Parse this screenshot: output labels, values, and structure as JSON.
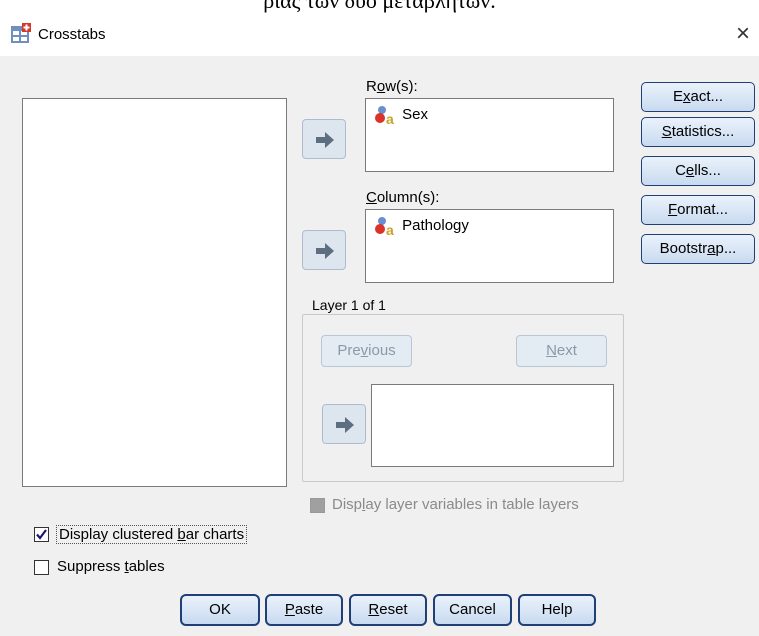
{
  "document": {
    "overlay_text": "ριας των δύο μεταβλητών."
  },
  "window": {
    "title": "Crosstabs",
    "close_symbol": "×"
  },
  "rows": {
    "label": "Row(s):",
    "items": [
      {
        "name": "Sex",
        "icon": "nominal-variable-icon"
      }
    ]
  },
  "columns": {
    "label": "Column(s):",
    "items": [
      {
        "name": "Pathology",
        "icon": "nominal-variable-icon"
      }
    ]
  },
  "layer": {
    "legend": "Layer 1 of 1",
    "previous_label": "Previous",
    "next_label": "Next",
    "display_in_table_layers_label": "Display layer variables in table layers",
    "display_in_table_layers_checked": false,
    "display_in_table_layers_enabled": false
  },
  "side_buttons": [
    {
      "label": "Exact..."
    },
    {
      "label": "Statistics..."
    },
    {
      "label": "Cells..."
    },
    {
      "label": "Format..."
    },
    {
      "label": "Bootstrap..."
    }
  ],
  "options": {
    "clustered_bar_charts": {
      "label": "Display clustered bar charts",
      "checked": true
    },
    "suppress_tables": {
      "label": "Suppress tables",
      "checked": false
    }
  },
  "bottom_buttons": [
    {
      "label": "OK"
    },
    {
      "label": "Paste"
    },
    {
      "label": "Reset"
    },
    {
      "label": "Cancel"
    },
    {
      "label": "Help"
    }
  ],
  "colors": {
    "dialog_bg": "#f0f0f0",
    "button_border": "#1f3f76",
    "arrow_button_bg": "#dde6ee",
    "checkmark": "#1a1a6e"
  }
}
